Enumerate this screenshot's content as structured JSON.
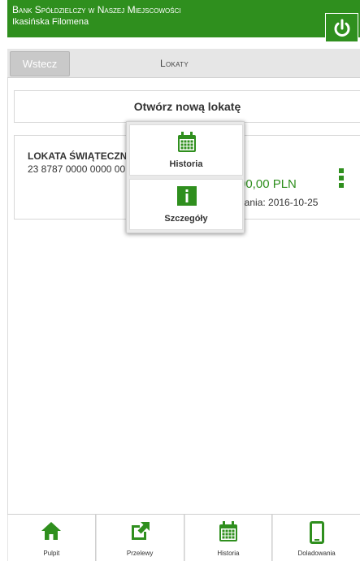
{
  "header": {
    "bank_name": "Bank Spółdzielczy w Naszej Miejscowości",
    "user_name": "Ikasińska Filomena",
    "power_icon": "power-icon"
  },
  "subbar": {
    "back_label": "Wstecz",
    "title": "Lokaty"
  },
  "main": {
    "open_new_label": "Otwórz nową lokatę",
    "deposit": {
      "name": "LOKATA ŚWIĄTECZN",
      "account": "23 8787 0000 0000 00",
      "amount": "00,00 PLN",
      "date": "dania: 2016-10-25",
      "menu_icon": "kebab-icon"
    }
  },
  "popup": {
    "items": [
      {
        "label": "Historia",
        "icon": "calendar-icon"
      },
      {
        "label": "Szczegóły",
        "icon": "info-icon"
      }
    ]
  },
  "bottom_nav": {
    "items": [
      {
        "label": "Pulpit",
        "icon": "home-icon"
      },
      {
        "label": "Przelewy",
        "icon": "external-link-icon"
      },
      {
        "label": "Historia",
        "icon": "calendar-icon"
      },
      {
        "label": "Doladowania",
        "icon": "mobile-icon"
      }
    ]
  },
  "colors": {
    "brand_green": "#2f8f1e",
    "background": "#ffffff",
    "subbar": "#e6e6e6"
  }
}
